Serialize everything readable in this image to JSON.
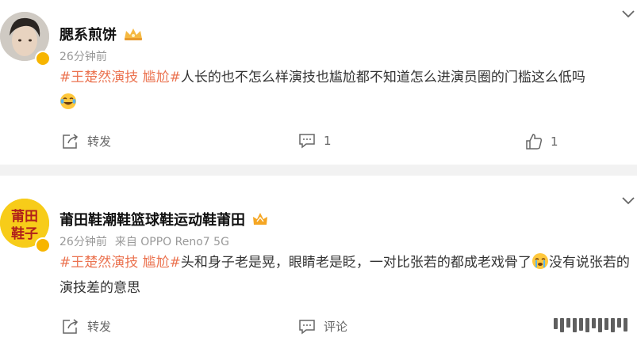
{
  "posts": [
    {
      "username": "腮系煎饼",
      "time": "26分钟前",
      "source": "",
      "tag1": "#王楚然演技 尴尬#",
      "text_part1": "人长的也不怎么样演技也尴尬都不知道怎么进演员圈的门槛这么低吗",
      "text_part2": "",
      "share_label": "转发",
      "comment_count": "1",
      "like_count": "1"
    },
    {
      "avatar_text_line1": "莆田",
      "avatar_text_line2": "鞋子",
      "username": "莆田鞋潮鞋篮球鞋运动鞋莆田",
      "time": "26分钟前",
      "source": "来自 OPPO Reno7 5G",
      "tag1": "#王楚然演技 尴尬#",
      "text_part1": "头和身子老是晃，眼睛老是眨，一对比张若的都成老戏骨了",
      "text_part2": "没有说张若的演技差的意思",
      "share_label": "转发",
      "comment_label": "评论"
    }
  ],
  "colors": {
    "accent": "#eb7350",
    "meta": "#999999",
    "divider": "#f2f2f2",
    "avatar2_bg": "#f7cc19"
  },
  "icons": [
    "share-icon",
    "comment-icon",
    "like-icon",
    "chevron-down-icon",
    "vip-crown-icon",
    "laugh-cry-emoji",
    "cry-emoji"
  ]
}
